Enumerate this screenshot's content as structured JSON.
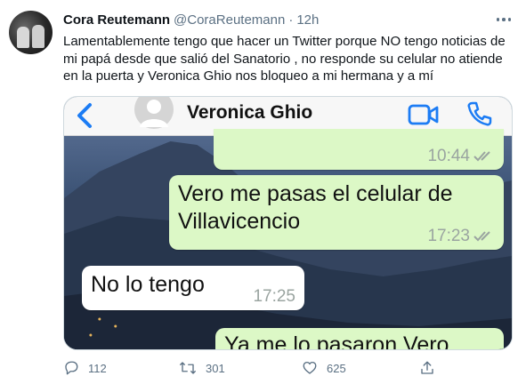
{
  "tweet": {
    "display_name": "Cora Reutemann",
    "handle": "@CoraReutemann",
    "separator": "·",
    "time": "12h",
    "text": "Lamentablemente tengo que hacer un Twitter porque NO tengo noticias de mi papá desde que salió del Sanatorio , no responde su celular no atiende en la puerta y Veronica Ghio nos bloqueo a mi hermana y a mí"
  },
  "chat": {
    "contact_name": "Veronica Ghio",
    "messages": [
      {
        "direction": "outgoing",
        "text": "",
        "time": "10:44"
      },
      {
        "direction": "outgoing",
        "text_line1": "Vero me pasas el celular de",
        "text_line2": "Villavicencio",
        "time": "17:23"
      },
      {
        "direction": "incoming",
        "text": "No lo tengo",
        "time": "17:25"
      },
      {
        "direction": "outgoing",
        "text": "Ya me lo pasaron Vero",
        "time": ""
      }
    ]
  },
  "actions": {
    "reply_count": "112",
    "retweet_count": "301",
    "like_count": "625"
  },
  "colors": {
    "name_text": "#0f1419",
    "secondary_text": "#5b7083",
    "whatsapp_blue": "#1c7cf4",
    "outgoing_bubble": "#dcf8c6",
    "incoming_bubble": "#ffffff",
    "read_ticks": "#9aa4a0"
  }
}
